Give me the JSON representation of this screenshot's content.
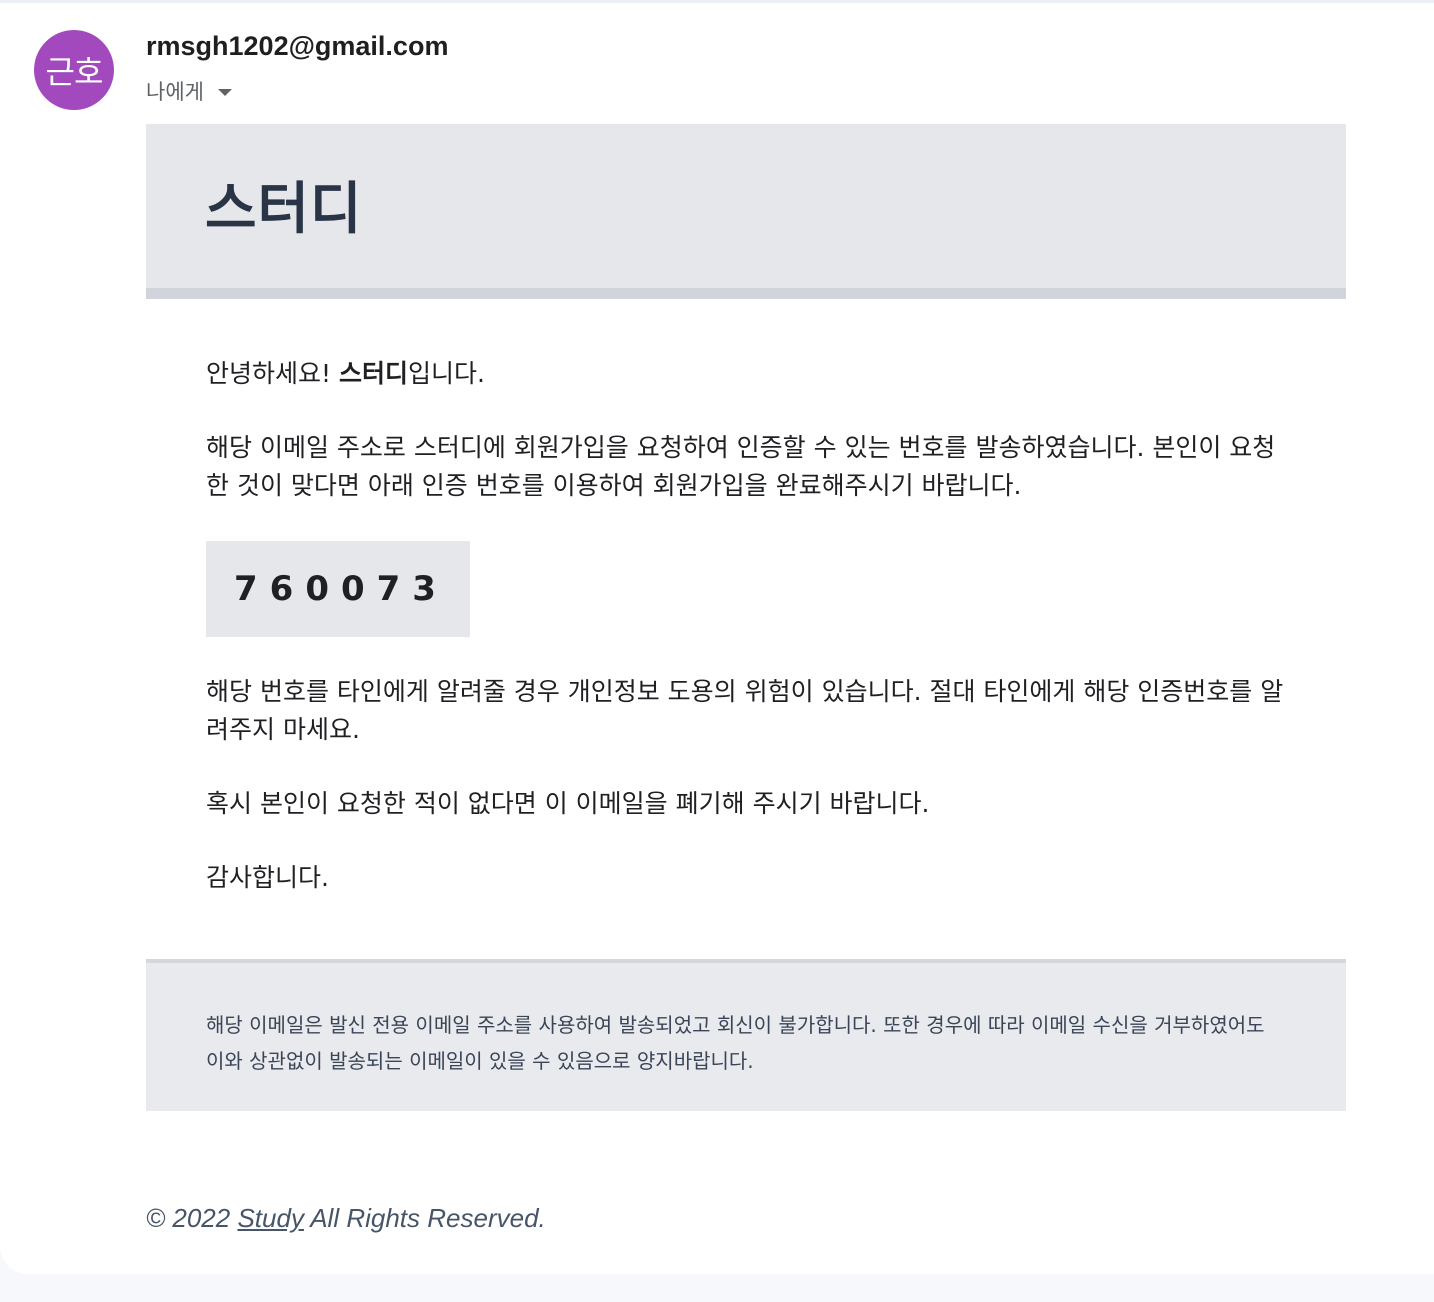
{
  "sender": {
    "avatar_text": "근호",
    "avatar_color": "#a349be",
    "email": "rmsgh1202@gmail.com",
    "recipient_label": "나에게"
  },
  "email": {
    "brand_title": "스터디",
    "greeting_prefix": "안녕하세요! ",
    "greeting_brand": "스터디",
    "greeting_suffix": "입니다.",
    "intro_text": "해당 이메일 주소로 스터디에 회원가입을 요청하여 인증할 수 있는 번호를 발송하였습니다. 본인이 요청한 것이 맞다면 아래 인증 번호를 이용하여 회원가입을 완료해주시기 바랍니다.",
    "verification_code": "760073",
    "warning_text": "해당 번호를 타인에게 알려줄 경우 개인정보 도용의 위험이 있습니다. 절대 타인에게 해당 인증번호를 알려주지 마세요.",
    "ignore_text": "혹시 본인이 요청한 적이 없다면 이 이메일을 폐기해 주시기 바랍니다.",
    "thanks_text": "감사합니다.",
    "footer_notice": "해당 이메일은 발신 전용 이메일 주소를 사용하여 발송되었고 회신이 불가합니다. 또한 경우에 따라 이메일 수신을 거부하였어도 이와 상관없이 발송되는 이메일이 있을 수 있음으로 양지바랍니다."
  },
  "copyright": {
    "prefix": "© 2022 ",
    "link_text": "Study",
    "suffix": " All Rights Reserved."
  }
}
